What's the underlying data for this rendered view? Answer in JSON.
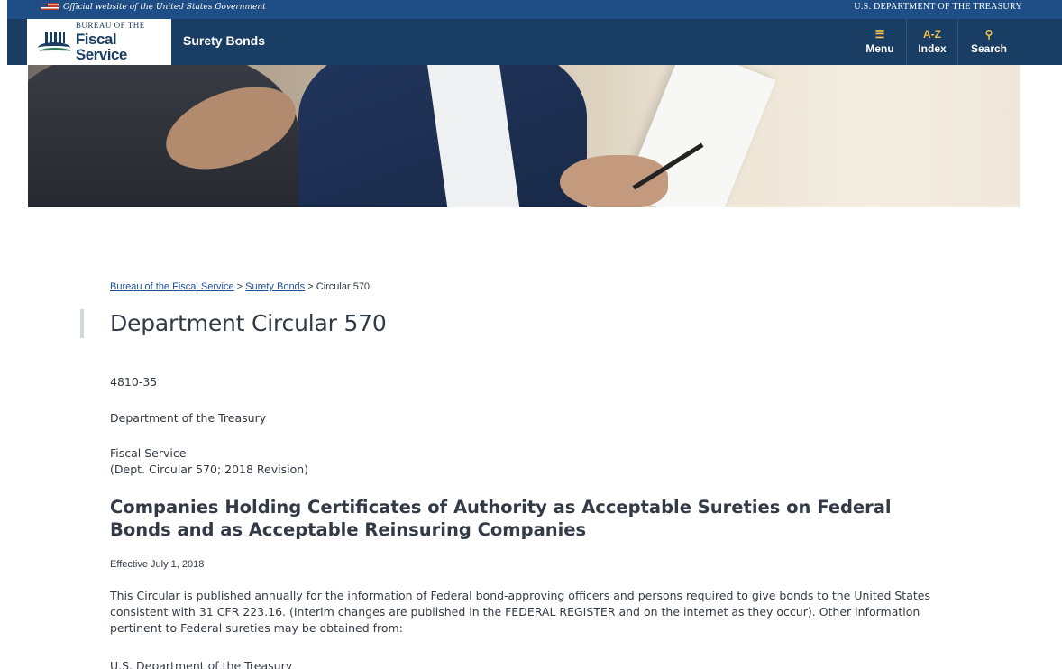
{
  "gov_banner": {
    "official_text": "Official website of the United States Government",
    "department": "U.S. DEPARTMENT OF THE TREASURY"
  },
  "header": {
    "logo_top": "BUREAU OF THE",
    "logo_bottom": "Fiscal Service",
    "site_name": "Surety Bonds",
    "nav": [
      {
        "icon": "menu-icon",
        "glyph": "☰",
        "label": "Menu"
      },
      {
        "icon": "az-index-icon",
        "glyph": "A-Z",
        "label": "Index"
      },
      {
        "icon": "search-icon",
        "glyph": "⚲",
        "label": "Search"
      }
    ]
  },
  "breadcrumb": {
    "items": [
      "Bureau of the Fiscal Service",
      "Surety Bonds"
    ],
    "separator": ">",
    "current": "Circular 570"
  },
  "main": {
    "title": "Department Circular 570",
    "number": "4810-35",
    "department": "Department of the Treasury",
    "fiscal_service": "Fiscal Service",
    "revision": "(Dept. Circular 570; 2018 Revision)",
    "heading": "Companies Holding Certificates of Authority as Acceptable Sureties on Federal Bonds and as Acceptable Reinsuring Companies",
    "effective": "Effective July 1, 2018",
    "body": "This Circular is published annually for the information of Federal bond-approving officers and persons required to give bonds to the United States consistent with 31 CFR 223.16. (Interim changes are published in the FEDERAL REGISTER and on the internet as they occur). Other information pertinent to Federal sureties may be obtained from:",
    "us_dept": "U.S. Department of the Treasury"
  },
  "colors": {
    "banner": "#1f4e87",
    "header": "#1a3d63",
    "nav_icon": "#f2c14e",
    "link": "#1f4e9e"
  }
}
